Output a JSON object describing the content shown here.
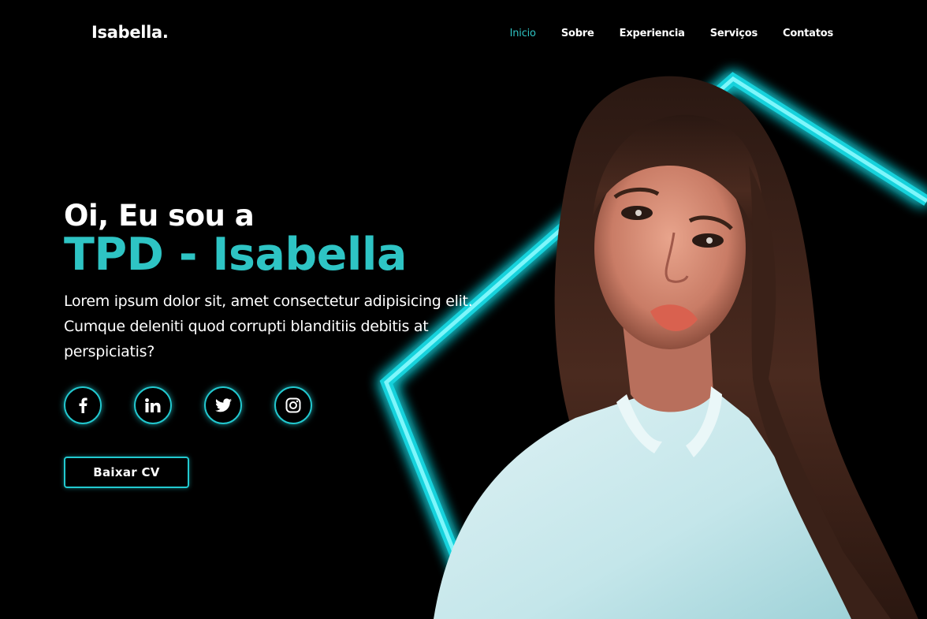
{
  "header": {
    "logo": "Isabella.",
    "nav": [
      {
        "label": "Inicio",
        "active": true
      },
      {
        "label": "Sobre",
        "active": false
      },
      {
        "label": "Experiencia",
        "active": false
      },
      {
        "label": "Serviços",
        "active": false
      },
      {
        "label": "Contatos",
        "active": false
      }
    ]
  },
  "hero": {
    "greeting": "Oi, Eu sou a",
    "name": "TPD - Isabella",
    "description": "Lorem ipsum dolor sit, amet consectetur adipisicing elit. Cumque deleniti quod corrupti blanditiis debitis at perspiciatis?",
    "socials": [
      {
        "icon": "facebook-icon"
      },
      {
        "icon": "linkedin-icon"
      },
      {
        "icon": "twitter-icon"
      },
      {
        "icon": "instagram-icon"
      }
    ],
    "cv_button": "Baixar CV"
  },
  "colors": {
    "accent": "#2ec4c4",
    "glow": "#22c9d0",
    "background": "#000000"
  }
}
